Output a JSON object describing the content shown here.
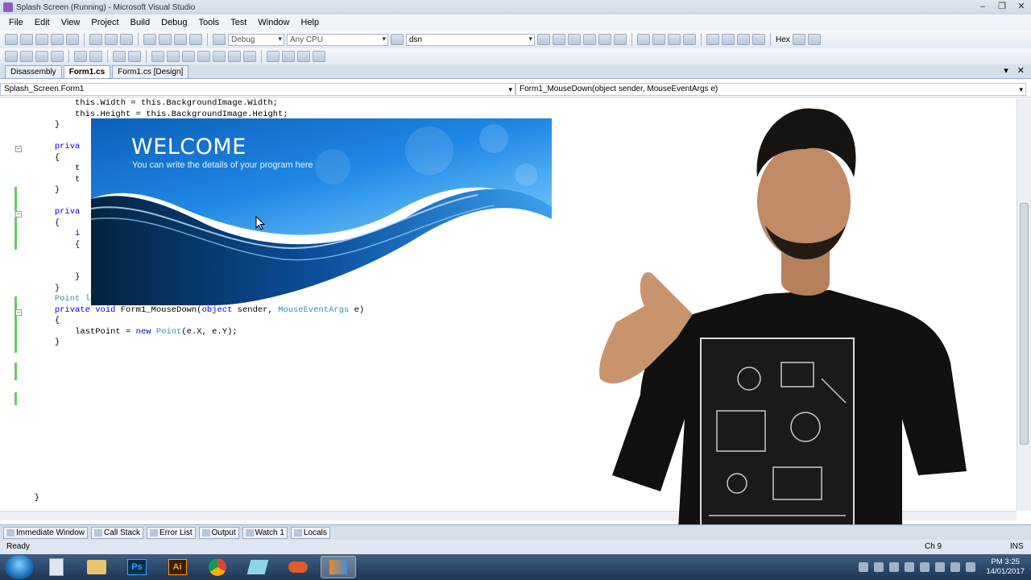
{
  "window": {
    "title": "Splash Screen (Running) - Microsoft Visual Studio"
  },
  "menu": [
    "File",
    "Edit",
    "View",
    "Project",
    "Build",
    "Debug",
    "Tools",
    "Test",
    "Window",
    "Help"
  ],
  "toolbar": {
    "config": "Debug",
    "platform": "Any CPU",
    "find": "dsn",
    "hex_label": "Hex"
  },
  "tabs": [
    {
      "label": "Disassembly"
    },
    {
      "label": "Form1.cs"
    },
    {
      "label": "Form1.cs [Design]"
    }
  ],
  "nav": {
    "left": "Splash_Screen.Form1",
    "right": "Form1_MouseDown(object sender, MouseEventArgs e)"
  },
  "code": {
    "l1": "this.Width = this.BackgroundImage.Width;",
    "l2": "this.Height = this.BackgroundImage.Height;",
    "l3": "}",
    "l4": "priva",
    "l5": "{",
    "l6": "t",
    "l7": "t",
    "l8": "}",
    "l9": "priva",
    "l10": "{",
    "l11": "i",
    "l12": "{",
    "l13": "}",
    "l14": "}",
    "l15": "Point last",
    "l16_kw": "private void",
    "l16_rest": " Form1_MouseDown(",
    "l16_obj": "object",
    "l16_rest2": " sender, ",
    "l16_ty": "MouseEventArgs",
    "l16_end": " e)",
    "l17": "{",
    "l18_a": "lastPoint = ",
    "l18_kw": "new",
    "l18_ty": " Point",
    "l18_b": "(e.X, e.Y);",
    "l19": "}",
    "l20": "}"
  },
  "splash": {
    "title": "WELCOME",
    "subtitle": "You can write the details of your program here",
    "colors": {
      "dark": "#0b4f9c",
      "mid": "#1e88e5",
      "light": "#6cc3ff"
    }
  },
  "toolwindows": [
    "Immediate Window",
    "Call Stack",
    "Error List",
    "Output",
    "Watch 1",
    "Locals"
  ],
  "status": {
    "left": "Ready",
    "ch": "Ch 9",
    "mode": "INS"
  },
  "taskbar": {
    "apps": [
      "windows-explorer",
      "photoshop",
      "illustrator",
      "chrome",
      "notepad",
      "visual-studio-alt",
      "visual-studio"
    ],
    "ps_label": "Ps",
    "ai_label": "Ai",
    "time": "PM 3:25",
    "date": "14/01/2017"
  }
}
